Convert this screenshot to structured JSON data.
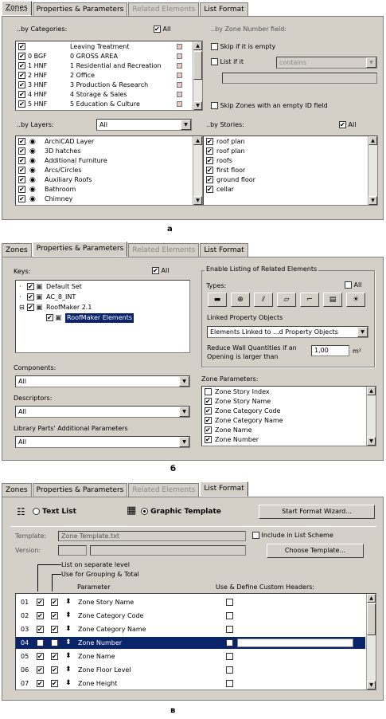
{
  "tabs": [
    "Zones",
    "Properties & Parameters",
    "Related Elements",
    "List Format"
  ],
  "captions": {
    "a": "a",
    "b": "б",
    "c": "в"
  },
  "panel_a": {
    "by_categories_label": "..by Categories:",
    "all_label": "All",
    "categories": [
      {
        "code": "",
        "name": "Leaving Treatment",
        "checked": true
      },
      {
        "code": "0 BGF",
        "name": "0 GROSS AREA",
        "checked": true
      },
      {
        "code": "1 HNF",
        "name": "1 Residential and Recreation",
        "checked": true
      },
      {
        "code": "2 HNF",
        "name": "2 Office",
        "checked": true
      },
      {
        "code": "3 HNF",
        "name": "3 Production & Research",
        "checked": true
      },
      {
        "code": "4 HNF",
        "name": "4 Storage & Sales",
        "checked": true
      },
      {
        "code": "5 HNF",
        "name": "5 Education & Culture",
        "checked": true
      }
    ],
    "zone_number_label": "..by Zone Number field:",
    "skip_if_empty": "Skip if it is empty",
    "list_if_it": "List if it",
    "contains_option": "contains",
    "skip_zones_label": "Skip Zones with an empty ID field",
    "by_layers_label": "..by Layers:",
    "layers_select": "All",
    "layers": [
      "ArchiCAD Layer",
      "3D hatches",
      "Additional Furniture",
      "Arcs/Circles",
      "Auxiliary Roofs",
      "Bathroom",
      "Chimney"
    ],
    "by_stories_label": "..by Stories:",
    "stories_all": "All",
    "stories": [
      "roof plan",
      "roof plan",
      "roofs",
      "first floor",
      "ground floor",
      "cellar"
    ]
  },
  "panel_b": {
    "keys_label": "Keys:",
    "all_label": "All",
    "tree": [
      {
        "label": "Default Set",
        "level": 0
      },
      {
        "label": "AC_8_INT",
        "level": 0
      },
      {
        "label": "RoofMaker 2.1",
        "level": 0
      },
      {
        "label": "RoofMaker Elements",
        "level": 1
      }
    ],
    "components_label": "Components:",
    "components_value": "All",
    "descriptors_label": "Descriptors:",
    "descriptors_value": "All",
    "library_label": "Library Parts' Additional Parameters",
    "library_value": "All",
    "enable_group_label": "Enable Listing of Related Elements",
    "types_label": "Types:",
    "types_all": "All",
    "linked_label": "Linked Property Objects",
    "linked_value": "Elements Linked to ...d Property Objects",
    "reduce_label_1": "Reduce Wall Quantities if an",
    "reduce_label_2": "Opening is larger than",
    "reduce_value": "1,00",
    "reduce_unit": "m²",
    "zone_params_label": "Zone Parameters:",
    "zone_params": [
      {
        "label": "Zone Story Index",
        "checked": false
      },
      {
        "label": "Zone Story Name",
        "checked": true
      },
      {
        "label": "Zone Category Code",
        "checked": true
      },
      {
        "label": "Zone Category Name",
        "checked": true
      },
      {
        "label": "Zone Name",
        "checked": true
      },
      {
        "label": "Zone Number",
        "checked": true
      }
    ]
  },
  "panel_c": {
    "text_list": "Text List",
    "graphic_template": "Graphic Template",
    "start_wizard": "Start Format Wizard...",
    "template_label": "Template:",
    "template_value": "Zone Template.txt",
    "include_label": "Include in List Scheme",
    "version_label": "Version:",
    "choose_template": "Choose Template...",
    "list_separate": "List on separate level",
    "use_grouping": "Use for Grouping & Total",
    "param_header": "Parameter",
    "custom_header": "Use & Define Custom Headers:",
    "rows": [
      {
        "num": "01",
        "name": "Zone Story Name"
      },
      {
        "num": "02",
        "name": "Zone Category Code"
      },
      {
        "num": "03",
        "name": "Zone Category Name"
      },
      {
        "num": "04",
        "name": "Zone Number"
      },
      {
        "num": "05",
        "name": "Zone Name"
      },
      {
        "num": "06",
        "name": "Zone Floor Level"
      },
      {
        "num": "07",
        "name": "Zone Height"
      }
    ],
    "selected_row": "04"
  }
}
